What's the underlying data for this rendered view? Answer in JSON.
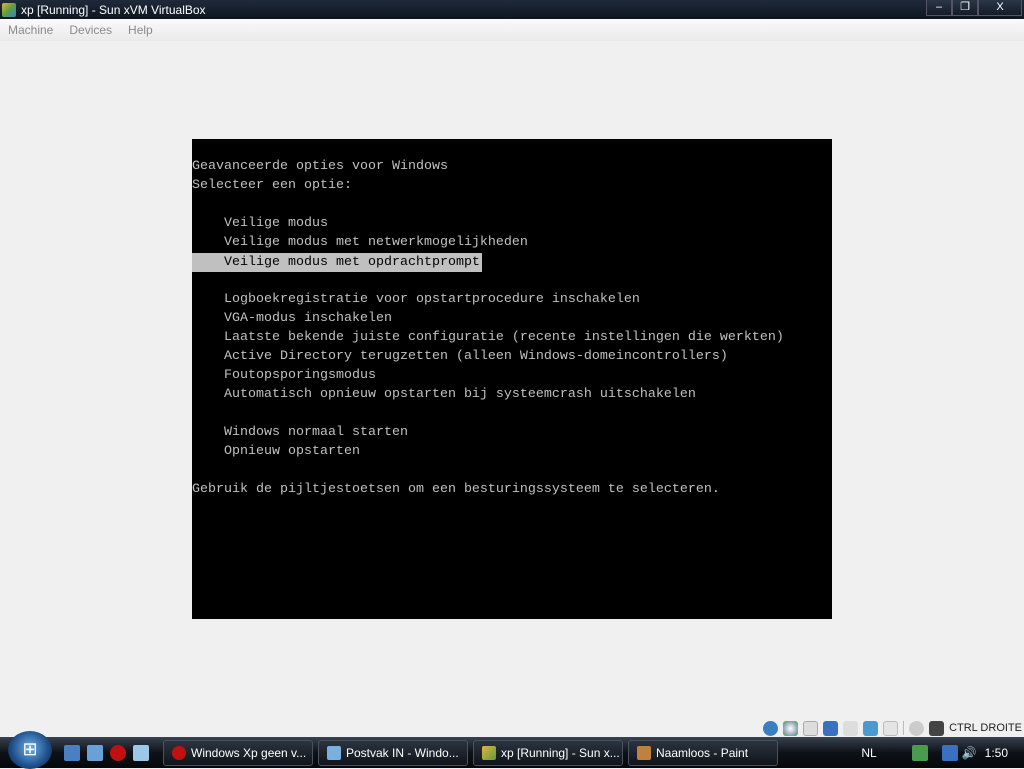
{
  "window": {
    "title": "xp [Running] - Sun xVM VirtualBox",
    "minimize": "–",
    "restore": "❐",
    "close": "X"
  },
  "menu": [
    "Machine",
    "Devices",
    "Help"
  ],
  "console": {
    "lines": [
      "Geavanceerde opties voor Windows",
      "Selecteer een optie:",
      "",
      "    Veilige modus",
      "    Veilige modus met netwerkmogelijkheden",
      "    Veilige modus met opdrachtprompt",
      "",
      "    Logboekregistratie voor opstartprocedure inschakelen",
      "    VGA-modus inschakelen",
      "    Laatste bekende juiste configuratie (recente instellingen die werkten)",
      "    Active Directory terugzetten (alleen Windows-domeincontrollers)",
      "    Foutopsporingsmodus",
      "    Automatisch opnieuw opstarten bij systeemcrash uitschakelen",
      "",
      "    Windows normaal starten",
      "    Opnieuw opstarten",
      "",
      "Gebruik de pijltjestoetsen om een besturingssysteem te selecteren."
    ],
    "selected_index": 5
  },
  "statusbar": {
    "hostkey": "CTRL DROITE",
    "icons": [
      "hard-disk-icon",
      "cd-icon",
      "floppy-icon",
      "network-icon",
      "usb-icon",
      "shared-folder-icon",
      "vrdp-icon",
      "mouse-integration-icon",
      "host-key-icon"
    ]
  },
  "taskbar": {
    "tasks": [
      "Windows Xp geen v...",
      "Postvak IN - Windo...",
      "xp [Running] - Sun x...",
      "Naamloos - Paint"
    ],
    "language": "NL",
    "clock": "1:50"
  }
}
